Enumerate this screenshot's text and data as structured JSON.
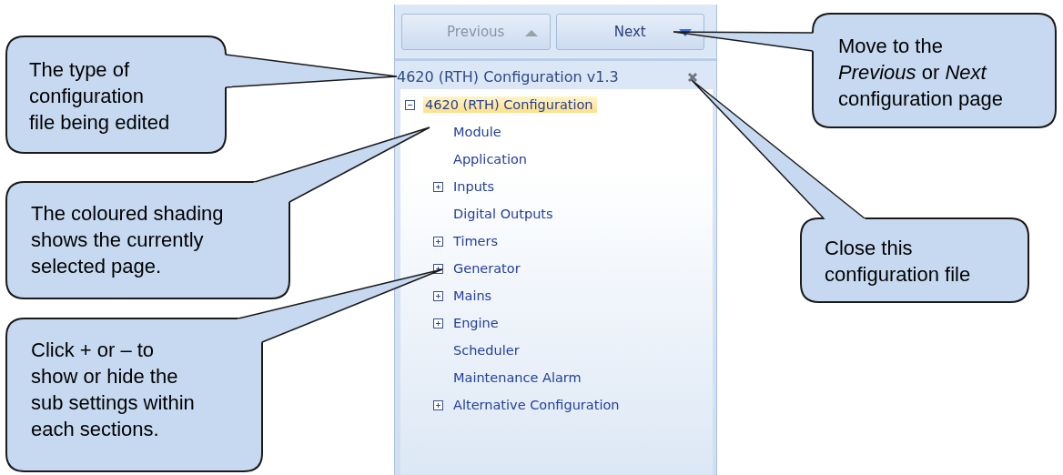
{
  "nav_buttons": [
    {
      "label": "Previous",
      "disabled": true
    },
    {
      "label": "Next",
      "disabled": false
    }
  ],
  "file_title": "4620 (RTH) Configuration v1.3",
  "tree": {
    "label": "4620 (RTH) Configuration",
    "expanded": true,
    "selected": true,
    "children": [
      {
        "label": "Module",
        "kind": "page",
        "selected": false
      },
      {
        "label": "Application",
        "kind": "page",
        "selected": false
      },
      {
        "label": "Inputs",
        "kind": "group",
        "expanded": false,
        "selected": false
      },
      {
        "label": "Digital Outputs",
        "kind": "page",
        "selected": false
      },
      {
        "label": "Timers",
        "kind": "group",
        "expanded": false,
        "selected": false
      },
      {
        "label": "Generator",
        "kind": "group",
        "expanded": false,
        "selected": false
      },
      {
        "label": "Mains",
        "kind": "group",
        "expanded": false,
        "selected": false
      },
      {
        "label": "Engine",
        "kind": "group",
        "expanded": false,
        "selected": false
      },
      {
        "label": "Scheduler",
        "kind": "page",
        "selected": false
      },
      {
        "label": "Maintenance Alarm",
        "kind": "page",
        "selected": false
      },
      {
        "label": "Alternative Configuration",
        "kind": "group",
        "expanded": false,
        "selected": false
      }
    ]
  },
  "callouts": [
    {
      "text": "The type of\nconfiguration\nfile being edited"
    },
    {
      "text": "The coloured shading\nshows the currently\nselected page."
    },
    {
      "text": "Click + or – to\nshow or hide the\nsub settings within\neach sections."
    },
    {
      "text": "Move to the\n*Previous* or *Next*\nconfiguration page"
    },
    {
      "text": "Close this\nconfiguration file"
    }
  ]
}
